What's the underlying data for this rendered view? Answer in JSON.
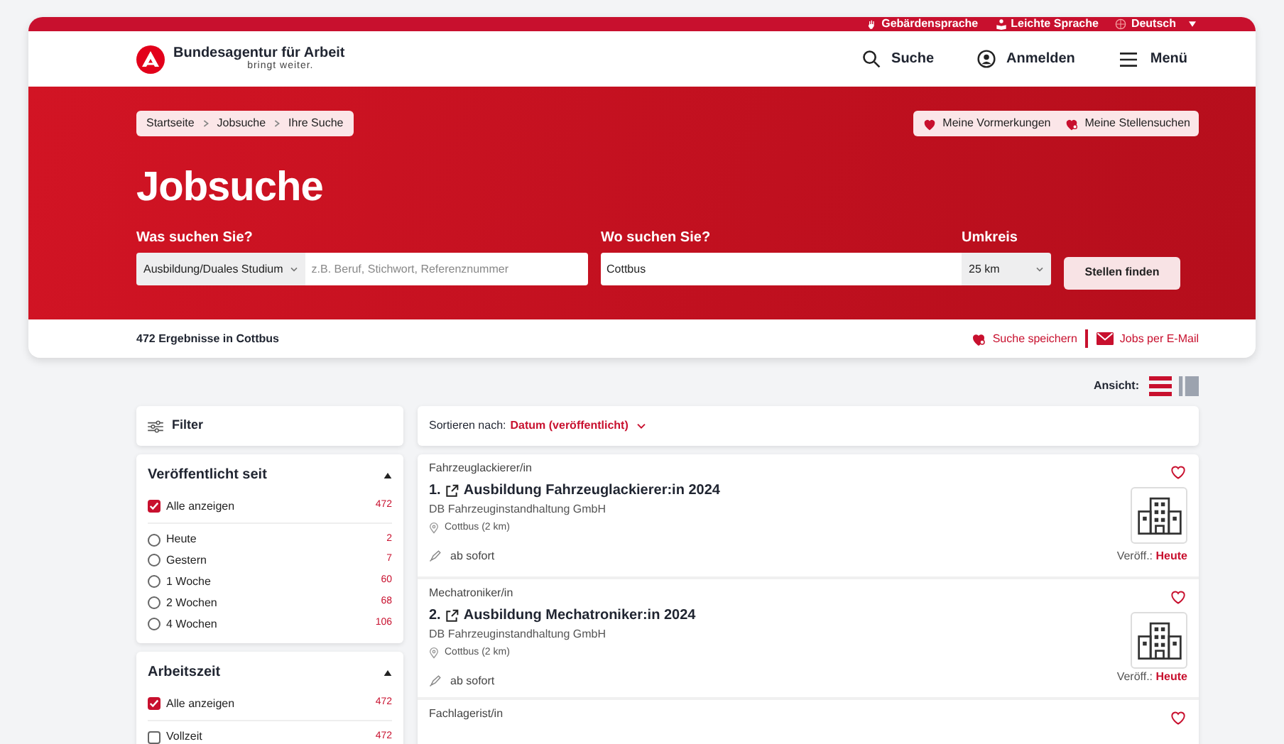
{
  "top_bar": {
    "links": [
      {
        "kind": "sign",
        "label": "Gebärdensprache"
      },
      {
        "kind": "easy",
        "label": "Leichte Sprache"
      },
      {
        "kind": "language",
        "label": "Deutsch"
      }
    ]
  },
  "header": {
    "logo": {
      "name": "Bundesagentur für Arbeit",
      "tagline": "bringt weiter."
    },
    "nav": [
      {
        "kind": "search",
        "label": "Suche"
      },
      {
        "kind": "account",
        "label": "Anmelden"
      },
      {
        "kind": "menu",
        "label": "Menü"
      }
    ]
  },
  "hero": {
    "breadcrumb": [
      "Startseite",
      "Jobsuche",
      "Ihre Suche"
    ],
    "shortcuts": [
      {
        "kind": "bookmarks",
        "label": "Meine Vormerkungen"
      },
      {
        "kind": "searches",
        "label": "Meine Stellensuchen"
      }
    ],
    "title": "Jobsuche",
    "search": {
      "what_label": "Was suchen Sie?",
      "category": "Ausbildung/Duales Studium",
      "placeholder": "z.B. Beruf, Stichwort, Referenznummer",
      "where_label": "Wo suchen Sie?",
      "where_value": "Cottbus",
      "radius_label": "Umkreis",
      "radius_value": "25 km",
      "submit": "Stellen finden"
    }
  },
  "results_bar": {
    "count": "472 Ergebnisse in Cottbus",
    "actions": [
      {
        "kind": "save",
        "label": "Suche speichern"
      },
      {
        "kind": "mail",
        "label": "Jobs per E-Mail"
      }
    ]
  },
  "view": {
    "label": "Ansicht:",
    "options": [
      {
        "kind": "list",
        "selected": true
      },
      {
        "kind": "columns",
        "selected": false
      }
    ]
  },
  "filter": {
    "title": "Filter",
    "groups": [
      {
        "title": "Veröffentlicht seit",
        "expanded": true,
        "options": [
          {
            "kind": "checkbox",
            "label": "Alle anzeigen",
            "count": "472",
            "checked": true
          },
          {
            "kind": "radio",
            "label": "Heute",
            "count": "2",
            "checked": false
          },
          {
            "kind": "radio",
            "label": "Gestern",
            "count": "7",
            "checked": false
          },
          {
            "kind": "radio",
            "label": "1 Woche",
            "count": "60",
            "checked": false
          },
          {
            "kind": "radio",
            "label": "2 Wochen",
            "count": "68",
            "checked": false
          },
          {
            "kind": "radio",
            "label": "4 Wochen",
            "count": "106",
            "checked": false
          }
        ]
      },
      {
        "title": "Arbeitszeit",
        "expanded": true,
        "options": [
          {
            "kind": "checkbox",
            "label": "Alle anzeigen",
            "count": "472",
            "checked": true
          },
          {
            "kind": "checkbox",
            "label": "Vollzeit",
            "count": "472",
            "checked": false
          }
        ]
      }
    ]
  },
  "sort": {
    "label": "Sortieren nach:",
    "value": "Datum (veröffentlicht)"
  },
  "jobs": [
    {
      "category": "Fahrzeuglackierer/in",
      "number": "1.",
      "title": "Ausbildung Fahrzeuglackierer:in 2024",
      "employer": "DB Fahrzeuginstandhaltung GmbH",
      "location": "Cottbus (2 km)",
      "start": "ab sofort",
      "published_label": "Veröff.:",
      "published_value": "Heute"
    },
    {
      "category": "Mechatroniker/in",
      "number": "2.",
      "title": "Ausbildung Mechatroniker:in 2024",
      "employer": "DB Fahrzeuginstandhaltung GmbH",
      "location": "Cottbus (2 km)",
      "start": "ab sofort",
      "published_label": "Veröff.:",
      "published_value": "Heute"
    },
    {
      "category": "Fachlagerist/in"
    }
  ]
}
